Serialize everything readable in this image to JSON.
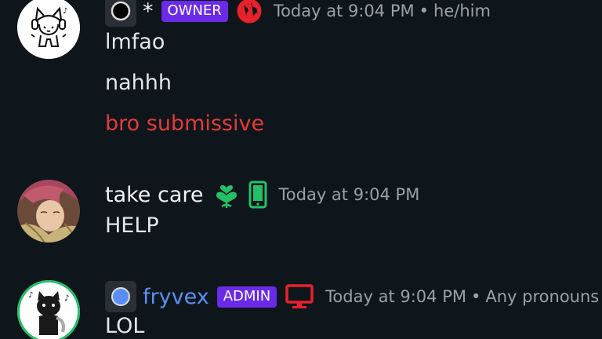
{
  "colors": {
    "background": "#0f161b",
    "badge_purple": "#6a2be8",
    "red_text": "#e33a3a",
    "green_icon": "#23c068",
    "red_icon": "#e8212b",
    "blue_name": "#5b8ef5"
  },
  "messages": [
    {
      "avatar_icon": "cat-headphones-avatar",
      "username": "*",
      "role_badge": "OWNER",
      "status_icon": "globe-icon",
      "timestamp": "Today at 9:04 PM",
      "separator": "•",
      "pronouns": "he/him",
      "lines": [
        "lmfao",
        "nahhh",
        "bro submissive"
      ]
    },
    {
      "avatar_icon": "anime-character-avatar",
      "username": "take care",
      "role_icon": "green-heart-leaf-icon",
      "status_icon": "mobile-phone-icon",
      "timestamp": "Today at 9:04 PM",
      "lines": [
        "HELP"
      ]
    },
    {
      "avatar_icon": "black-cat-avatar",
      "username": "fryvex",
      "role_badge": "ADMIN",
      "status_icon": "desktop-monitor-icon",
      "timestamp": "Today at 9:04 PM",
      "separator": "•",
      "pronouns": "Any pronouns",
      "lines": [
        "LOL"
      ]
    }
  ]
}
